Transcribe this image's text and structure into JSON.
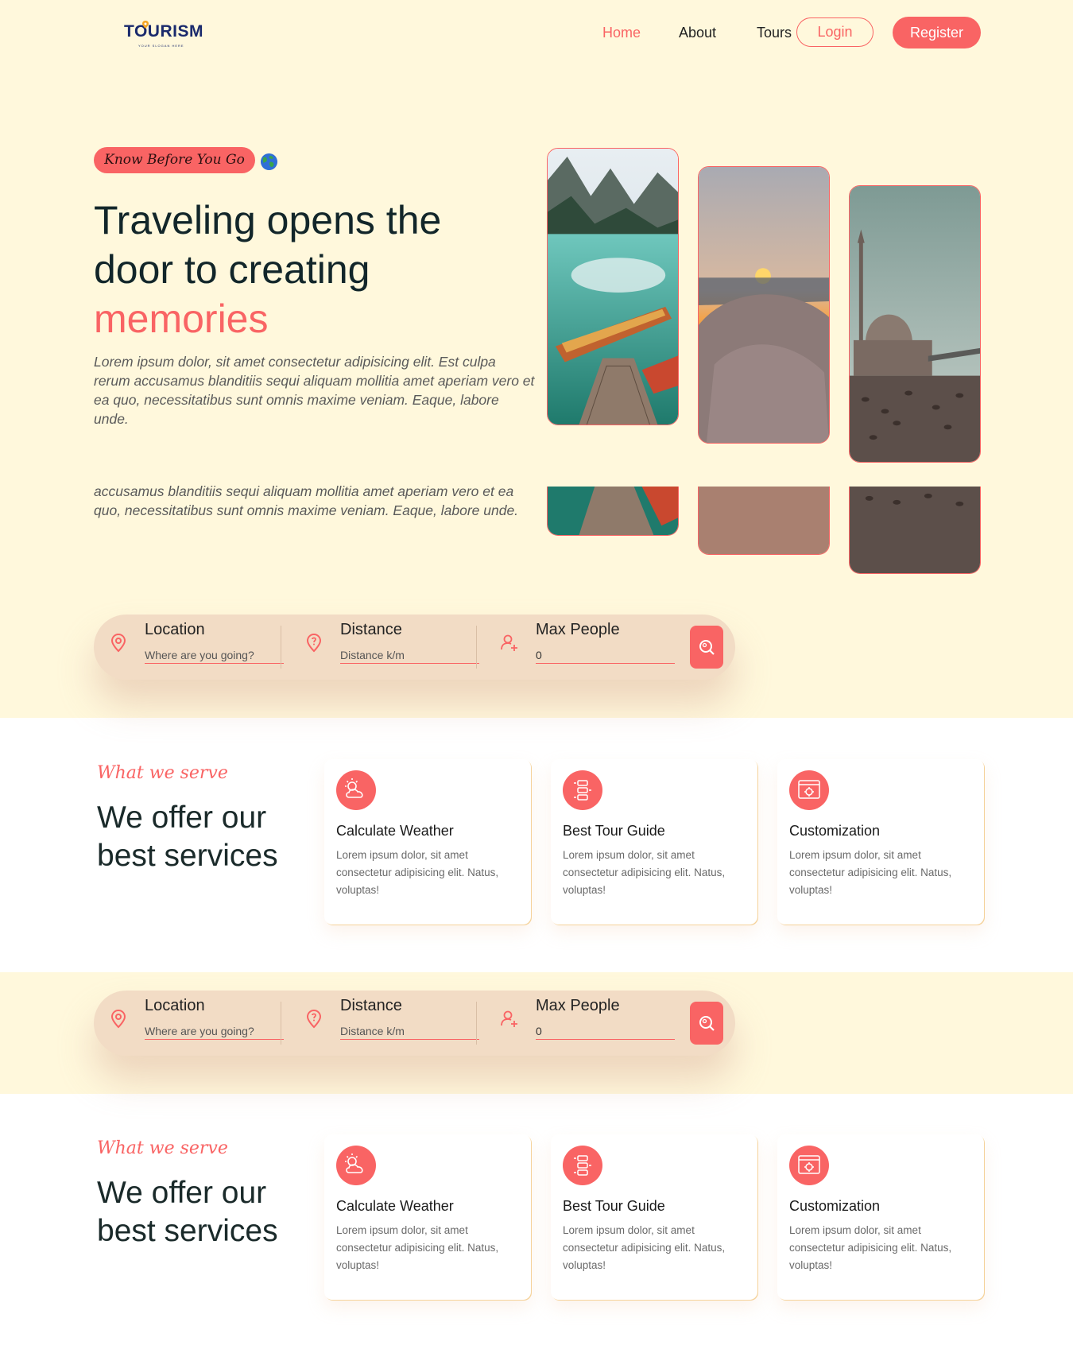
{
  "brand": {
    "logo_text": "TOURISM",
    "slogan": "YOUR SLOGAN HERE",
    "accent_color": "#f96464",
    "cream_color": "#fff8dc"
  },
  "nav": {
    "home": "Home",
    "about": "About",
    "tours": "Tours",
    "login": "Login",
    "register": "Register"
  },
  "hero": {
    "subtitle": "Know Before You Go",
    "title_line1": "Traveling opens the",
    "title_line2": "door to creating",
    "title_highlight": "memories",
    "description": "Lorem ipsum dolor, sit amet consectetur adipisicing elit. Est culpa rerum accusamus blanditiis sequi aliquam mollitia amet aperiam vero et ea quo, necessitatibus sunt omnis maxime veniam. Eaque, labore unde.",
    "description_dup": "accusamus blanditiis sequi aliquam mollitia amet aperiam vero et ea quo, necessitatibus sunt omnis maxime veniam. Eaque, labore unde.",
    "images": [
      "mountain-lake-boat-photo",
      "beach-sunset-photo",
      "mosque-waterfront-photo"
    ]
  },
  "search": {
    "location_label": "Location",
    "location_placeholder": "Where are you going?",
    "distance_label": "Distance",
    "distance_placeholder": "Distance k/m",
    "people_label": "Max People",
    "people_value": "0"
  },
  "services": {
    "tag": "What we serve",
    "title": "We offer our best services",
    "cards": [
      {
        "icon": "weather-icon",
        "title": "Calculate Weather",
        "text": "Lorem ipsum dolor, sit amet consectetur adipisicing elit. Natus, voluptas!"
      },
      {
        "icon": "guide-icon",
        "title": "Best Tour Guide",
        "text": "Lorem ipsum dolor, sit amet consectetur adipisicing elit. Natus, voluptas!"
      },
      {
        "icon": "customization-icon",
        "title": "Customization",
        "text": "Lorem ipsum dolor, sit amet consectetur adipisicing elit. Natus, voluptas!"
      }
    ]
  }
}
